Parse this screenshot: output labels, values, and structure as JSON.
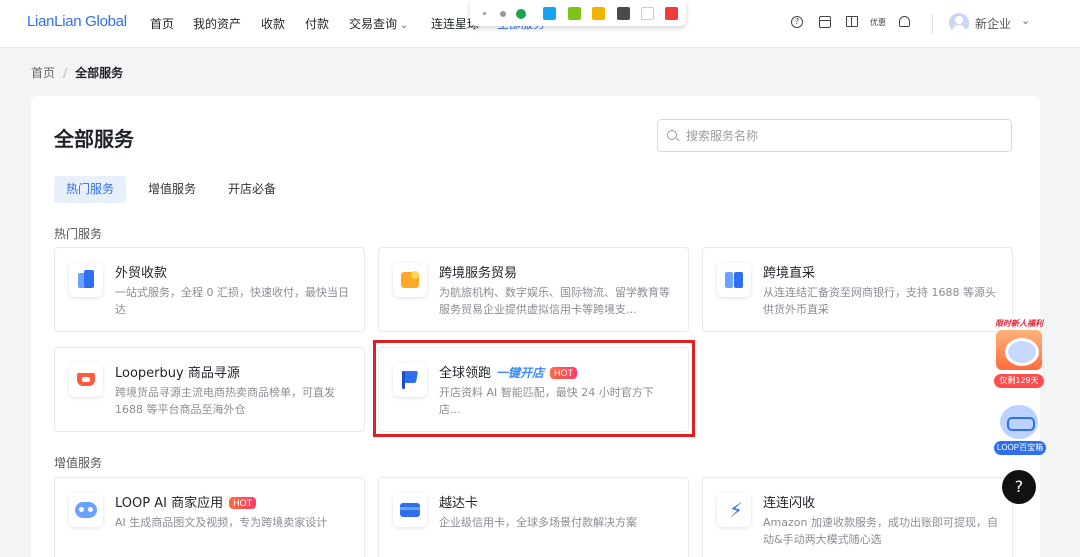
{
  "brand": {
    "logo": "LianLian Global",
    "accent": "#2f6fed",
    "highlight": "#e02020"
  },
  "nav": {
    "items": [
      "首页",
      "我的资产",
      "收款",
      "付款",
      "交易查询",
      "连连星球",
      "全部服务"
    ],
    "right": {
      "youhui": "优惠",
      "company": "新企业"
    }
  },
  "breadcrumb": {
    "home": "首页",
    "current": "全部服务"
  },
  "page": {
    "title": "全部服务",
    "search_placeholder": "搜索服务名称"
  },
  "tabs": [
    "热门服务",
    "增值服务",
    "开店必备"
  ],
  "sections": {
    "hot": {
      "title": "热门服务",
      "items": [
        {
          "name": "外贸收款",
          "desc": "一站式服务，全程 0 汇损，快速收付，最快当日达"
        },
        {
          "name": "跨境服务贸易",
          "desc": "为航旅机构、数字娱乐、国际物流、留学教育等服务贸易企业提供虚拟信用卡等跨境支..."
        },
        {
          "name": "跨境直采",
          "desc": "从连连结汇备资至网商银行，支持 1688 等源头供货外币直采"
        },
        {
          "name": "Looperbuy 商品寻源",
          "desc": "跨境货品寻源主流电商热卖商品榜单，可直发 1688 等平台商品至海外仓"
        },
        {
          "name": "全球领跑",
          "tag": "一键开店",
          "badge": "HOT",
          "desc": "开店资料 AI 智能匹配，最快 24 小时官方下店..."
        }
      ]
    },
    "value": {
      "title": "增值服务",
      "items": [
        {
          "name": "LOOP AI 商家应用",
          "badge": "HOT",
          "desc": "AI 生成商品图文及视频，专为跨境卖家设计"
        },
        {
          "name": "越达卡",
          "desc": "企业级信用卡，全球多场景付款解决方案"
        },
        {
          "name": "连连闪收",
          "desc": "Amazon 加速收款服务，成功出账即可提现，自动&手动两大模式随心选"
        }
      ]
    }
  },
  "widgets": {
    "promo_top": "限时新人福利",
    "promo_tag": "仅剩129天",
    "loop_tag": "LOOP百宝箱",
    "help": "?"
  },
  "toolbar_colors": [
    "#1aa3f0",
    "#7cc417",
    "#f2b400",
    "#4a4a4a",
    "#ffffff",
    "#ef3b3b"
  ]
}
